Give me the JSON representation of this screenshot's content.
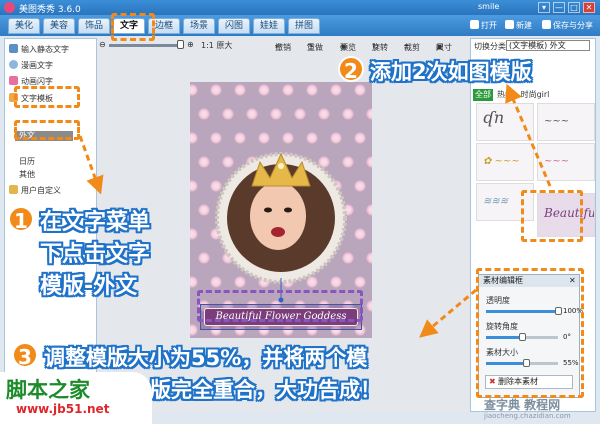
{
  "window": {
    "title": "美图秀秀 3.6.0",
    "user": "smile",
    "buttons": [
      "▾",
      "—",
      "□",
      "✕"
    ]
  },
  "menu": {
    "tabs": [
      {
        "label": "美化"
      },
      {
        "label": "美容"
      },
      {
        "label": "饰品"
      },
      {
        "label": "文字",
        "active": true
      },
      {
        "label": "边框"
      },
      {
        "label": "场景"
      },
      {
        "label": "闪图"
      },
      {
        "label": "娃娃"
      },
      {
        "label": "拼图"
      }
    ],
    "actions": {
      "open": "打开",
      "new": "新建",
      "save_share": "保存与分享"
    }
  },
  "left_panel": {
    "items": [
      {
        "label": "输入静态文字"
      },
      {
        "label": "漫画文字"
      },
      {
        "label": "动画闪字"
      }
    ],
    "template_group": "文字模板",
    "sub_items": [
      "外文",
      "日历",
      "其他"
    ],
    "custom": "用户自定义"
  },
  "canvas_toolbar": {
    "original_size": "1:1 原大",
    "undo": "撤销",
    "redo": "重做",
    "actions": [
      "预览",
      "旋转",
      "裁剪",
      "尺寸"
    ]
  },
  "photo": {
    "caption": "Beautiful Flower Goddess"
  },
  "right_panel": {
    "switch_label": "切换分类",
    "category_value": "(文字模板) 外文",
    "tabs": [
      "全部",
      "热门",
      "时尚girl"
    ],
    "thumb_texts": [
      "Beautiful"
    ]
  },
  "edit_panel": {
    "title": "素材编辑框",
    "transparency_label": "透明度",
    "transparency_value": "100%",
    "transparency_level": 1.0,
    "rotation_label": "旋转角度",
    "rotation_value": "0°",
    "rotation_level": 0.5,
    "size_label": "素材大小",
    "size_value": "55%",
    "size_level": 0.55,
    "delete_button": "删除本素材"
  },
  "annotations": {
    "step1": {
      "num": "1",
      "lines": [
        "在文字菜单",
        "下点击文字",
        "模版-外文"
      ]
    },
    "step2": {
      "num": "2",
      "text": "添加2次如图模版"
    },
    "step3": {
      "num": "3",
      "lines": [
        "调整模版大小为55%，并将两个模",
        "版完全重合，大功告成！"
      ]
    }
  },
  "watermarks": {
    "site_cn": "脚本之家",
    "site_url": "www.jb51.net",
    "site2": "查字典 教程网",
    "site2_url": "jiaocheng.chazidian.com"
  },
  "colors": {
    "accent_orange": "#f28a1a",
    "title_blue": "#2a74bd",
    "annotation_outline": "#1f72c8"
  }
}
